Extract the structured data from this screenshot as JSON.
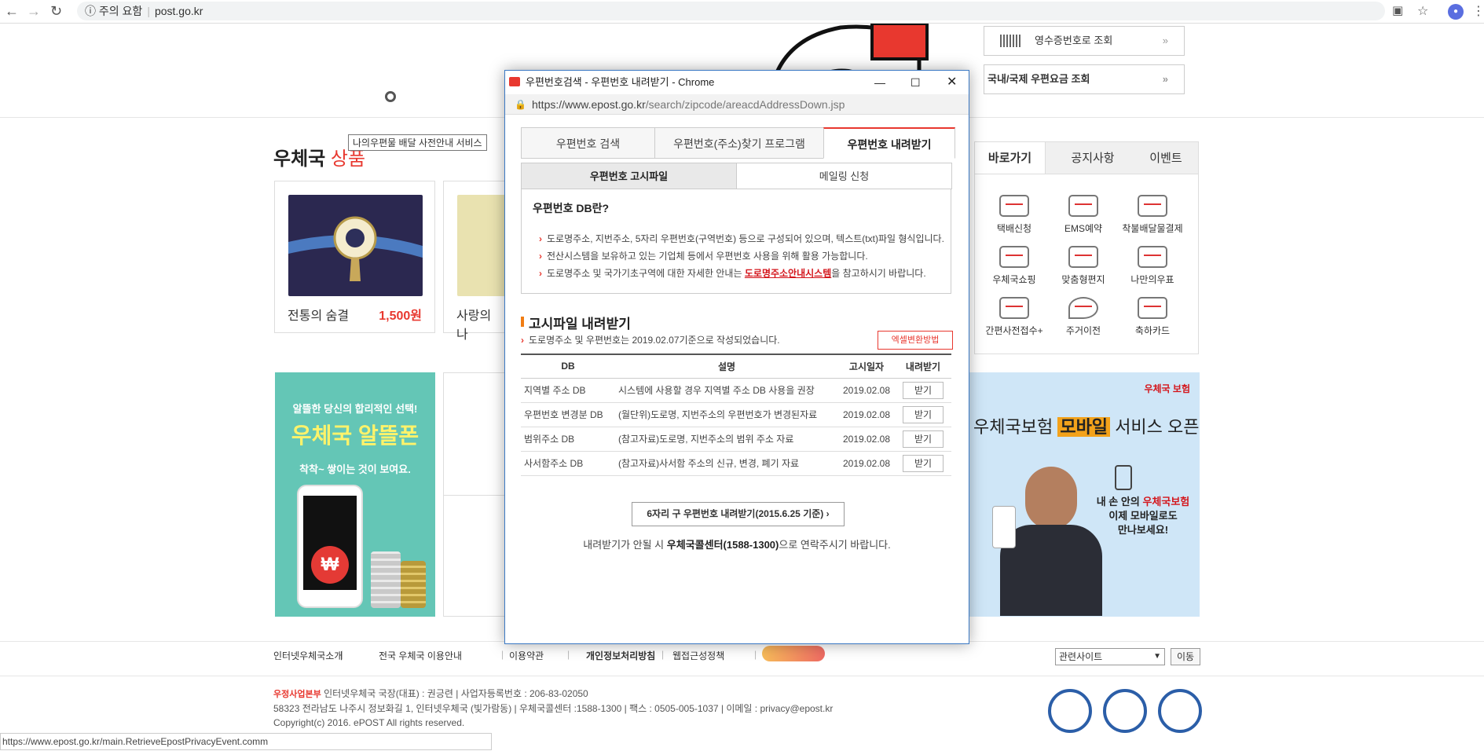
{
  "browser": {
    "security_label": "주의 요함",
    "url": "post.go.kr"
  },
  "tooltip": "나의우편물 배달 사전안내 서비스",
  "section": {
    "title_main": "우체국",
    "title_accent": "상품"
  },
  "products": [
    {
      "name": "전통의 숨결",
      "price": "1,500원"
    },
    {
      "name": "사랑의 나"
    }
  ],
  "util_links": [
    {
      "label": "영수증번호로 조회"
    },
    {
      "label": "국내/국제 우편요금 조회"
    }
  ],
  "right_tabs": [
    "바로가기",
    "공지사항",
    "이벤트"
  ],
  "quick_menu": [
    "택배신청",
    "EMS예약",
    "착불배달물결제",
    "우체국쇼핑",
    "맞춤형편지",
    "나만의우표",
    "간편사전접수+",
    "주거이전",
    "축하카드"
  ],
  "banner_phone": {
    "line1": "알뜰한 당신의 합리적인 선택!",
    "line2": "우체국 알뜰폰",
    "line3": "착착~ 쌓이는 것이 보여요."
  },
  "banner_insurance": {
    "brand": "우체국 보험",
    "headline_a": "우체국보험",
    "headline_b": "모바일",
    "headline_c": "서비스 오픈",
    "body1": "내 손 안의",
    "body1_red": "우체국보험",
    "body2": "이제 모바일로도",
    "body3": "만나보세요!"
  },
  "footer": {
    "links": [
      "인터넷우체국소개",
      "전국 우체국 이용안내",
      "이용약관",
      "개인정보처리방침",
      "웹접근성정책"
    ],
    "related_select": "관련사이트",
    "go_button": "이동",
    "org": "우정사업본부",
    "info1": "인터넷우체국 국장(대표) : 권긍련  |  사업자등록번호 : 206-83-02050",
    "info2": "58323 전라남도 나주시 정보화길 1, 인터넷우체국 (빛가람동)  |  우체국콜센터 :1588-1300  |  팩스 : 0505-005-1037  |  이메일 : privacy@epost.kr",
    "copyright": "Copyright(c) 2016. ePOST All rights reserved."
  },
  "status_url": "https://www.epost.go.kr/main.RetrieveEpostPrivacyEvent.comm",
  "popup": {
    "window_title": "우편번호검색 - 우편번호 내려받기 - Chrome",
    "address_host": "https://www.epost.go.kr",
    "address_path": "/search/zipcode/areacdAddressDown.jsp",
    "tabs": [
      "우편번호 검색",
      "우편번호(주소)찾기 프로그램",
      "우편번호 내려받기"
    ],
    "subtabs": [
      "우편번호 고시파일",
      "메일링 신청"
    ],
    "db_heading": "우편번호 DB란?",
    "db_bullets": [
      "도로명주소, 지번주소, 5자리 우편번호(구역번호) 등으로 구성되어 있으며, 텍스트(txt)파일 형식입니다.",
      "전산시스템을 보유하고 있는 기업체 등에서 우편번호 사용을 위해 활용 가능합니다.",
      "도로명주소 및 국가기초구역에 대한 자세한 안내는"
    ],
    "db_link": "도로명주소안내시스템",
    "db_link_suffix": "을 참고하시기 바랍니다.",
    "download_title": "고시파일 내려받기",
    "download_note": "도로명주소 및 우편번호는 2019.02.07기준으로 작성되었습니다.",
    "excel_button": "엑셀변환방법",
    "table_headers": [
      "DB",
      "설명",
      "고시일자",
      "내려받기"
    ],
    "table_rows": [
      {
        "db": "지역별 주소 DB",
        "desc": "시스템에 사용할 경우 지역별 주소 DB 사용을 권장",
        "date": "2019.02.08",
        "btn": "받기"
      },
      {
        "db": "우편번호 변경분 DB",
        "desc": "(월단위)도로명, 지번주소의 우편번호가 변경된자료",
        "date": "2019.02.08",
        "btn": "받기"
      },
      {
        "db": "범위주소 DB",
        "desc": "(참고자료)도로명, 지번주소의 범위 주소 자료",
        "date": "2019.02.08",
        "btn": "받기"
      },
      {
        "db": "사서함주소 DB",
        "desc": "(참고자료)사서함 주소의 신규, 변경, 폐기 자료",
        "date": "2019.02.08",
        "btn": "받기"
      }
    ],
    "old_button": "6자리 구 우편번호 내려받기(2015.6.25 기준)",
    "help_prefix": "내려받기가 안될 시",
    "help_bold": "우체국콜센터(1588-1300)",
    "help_suffix": "으로 연락주시기 바랍니다."
  }
}
